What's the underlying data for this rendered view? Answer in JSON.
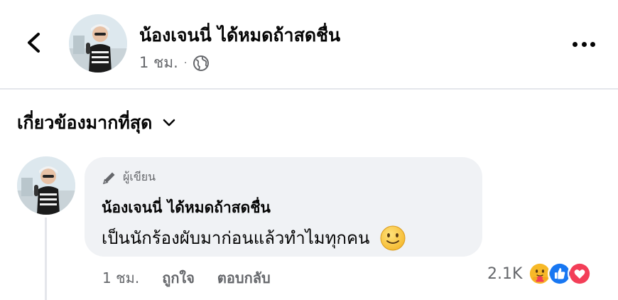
{
  "header": {
    "author_name": "น้องเจนนี่ ได้หมดถ้าสดชื่น",
    "time": "1 ชม.",
    "separator": "·",
    "privacy_icon": "globe-icon"
  },
  "sort": {
    "label": "เกี่ยวข้องมากที่สุด",
    "icon": "chevron-down-icon"
  },
  "comment": {
    "badge": "ผู้เขียน",
    "badge_icon": "pencil-icon",
    "author_name": "น้องเจนนี่ ได้หมดถ้าสดชื่น",
    "text": "เป็นนักร้องผับมาก่อนแล้วทำไมทุกคน",
    "emoji_icon": "slight-smile-icon",
    "time": "1 ชม.",
    "like_label": "ถูกใจ",
    "reply_label": "ตอบกลับ",
    "reaction_count": "2.1K",
    "reactions": [
      "care",
      "like",
      "love"
    ]
  },
  "colors": {
    "text": "#050505",
    "secondary": "#65676b",
    "bubble": "#f0f2f5",
    "like_blue": "#1877f2",
    "love_red": "#f33e58",
    "care_yellow": "#f7b928"
  }
}
